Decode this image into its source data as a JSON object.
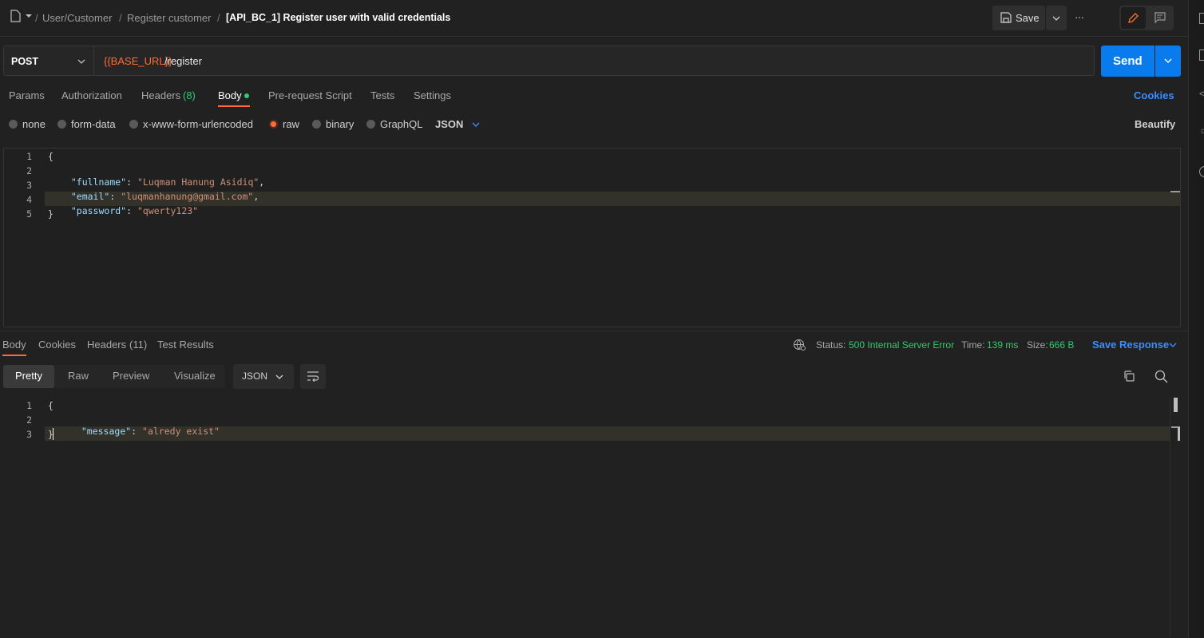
{
  "header": {
    "breadcrumbs": [
      "User/Customer",
      "Register customer",
      "[API_BC_1] Register user with valid credentials"
    ],
    "separator": "/",
    "save_label": "Save",
    "more_label": "···"
  },
  "request": {
    "method": "POST",
    "url_variable": "{{BASE_URL}}",
    "url_path": "/register",
    "send_label": "Send"
  },
  "request_tabs": {
    "params": "Params",
    "authorization": "Authorization",
    "headers": "Headers",
    "headers_count": "(8)",
    "body": "Body",
    "pre_request": "Pre-request Script",
    "tests": "Tests",
    "settings": "Settings",
    "cookies": "Cookies"
  },
  "body_options": {
    "none": "none",
    "form_data": "form-data",
    "urlencoded": "x-www-form-urlencoded",
    "raw": "raw",
    "binary": "binary",
    "graphql": "GraphQL",
    "format": "JSON",
    "beautify": "Beautify"
  },
  "request_body": {
    "line_numbers": [
      "1",
      "2",
      "3",
      "4",
      "5"
    ],
    "open": "{",
    "close": "}",
    "fields": [
      {
        "key": "\"fullname\"",
        "value": "\"Luqman Hanung Asidiq\"",
        "trail": ","
      },
      {
        "key": "\"email\"",
        "value": "\"luqmanhanung@gmail.com\"",
        "trail": ","
      },
      {
        "key": "\"password\"",
        "value": "\"qwerty123\"",
        "trail": ""
      }
    ]
  },
  "response_tabs": {
    "body": "Body",
    "cookies": "Cookies",
    "headers": "Headers",
    "headers_count": "(11)",
    "test_results": "Test Results"
  },
  "response_meta": {
    "status_label": "Status:",
    "status_value": "500 Internal Server Error",
    "time_label": "Time:",
    "time_value": "139 ms",
    "size_label": "Size:",
    "size_value": "666 B",
    "save_response": "Save Response"
  },
  "response_view": {
    "pretty": "Pretty",
    "raw": "Raw",
    "preview": "Preview",
    "visualize": "Visualize",
    "format": "JSON"
  },
  "response_body": {
    "line_numbers": [
      "1",
      "2",
      "3"
    ],
    "open": "{",
    "close": "}",
    "key": "\"message\"",
    "value": "\"alredy exist\""
  },
  "colors": {
    "accent": "#ff6c37",
    "primary": "#097bed",
    "success": "#2ecc71"
  }
}
